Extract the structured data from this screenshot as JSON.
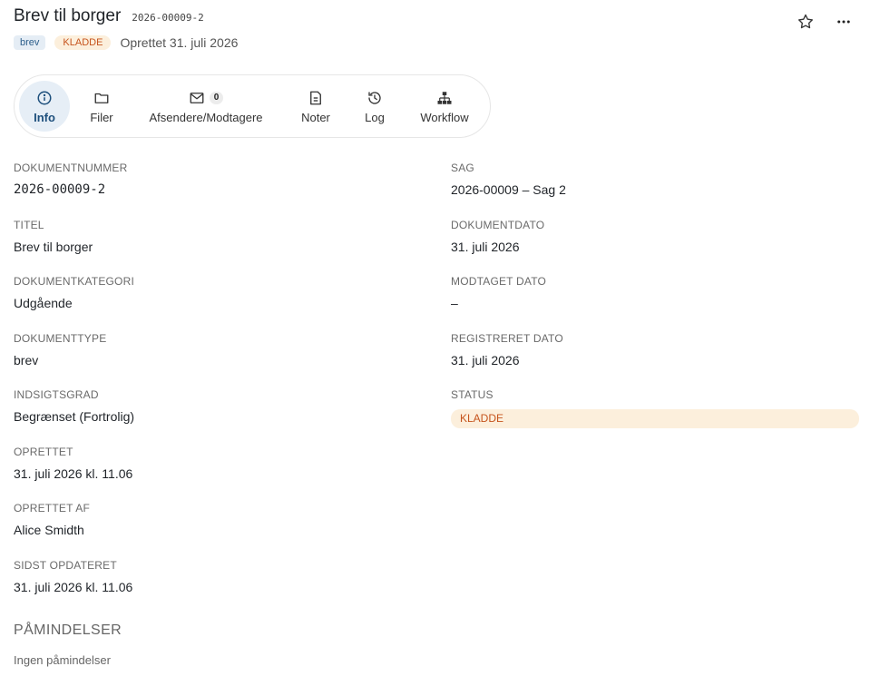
{
  "header": {
    "title": "Brev til borger",
    "doc_number": "2026-00009-2",
    "type_chip": "brev",
    "status_chip": "KLADDE",
    "created": "Oprettet 31. juli 2026"
  },
  "tabs": [
    {
      "label": "Info",
      "icon": "info-icon",
      "active": true
    },
    {
      "label": "Filer",
      "icon": "folder-icon"
    },
    {
      "label": "Afsendere/Modtagere",
      "icon": "mail-icon",
      "badge": "0"
    },
    {
      "label": "Noter",
      "icon": "note-icon"
    },
    {
      "label": "Log",
      "icon": "history-icon"
    },
    {
      "label": "Workflow",
      "icon": "workflow-icon"
    }
  ],
  "fields_left": [
    {
      "label": "DOKUMENTNUMMER",
      "value": "2026-00009-2"
    },
    {
      "label": "TITEL",
      "value": "Brev til borger"
    },
    {
      "label": "DOKUMENTKATEGORI",
      "value": "Udgående"
    },
    {
      "label": "DOKUMENTTYPE",
      "value": "brev"
    },
    {
      "label": "INDSIGTSGRAD",
      "value": "Begrænset (Fortrolig)"
    },
    {
      "label": "OPRETTET",
      "value": "31. juli 2026 kl. 11.06"
    },
    {
      "label": "OPRETTET AF",
      "value": "Alice Smidth"
    },
    {
      "label": "SIDST OPDATERET",
      "value": "31. juli 2026 kl. 11.06"
    }
  ],
  "fields_right": [
    {
      "label": "SAG",
      "value": "2026-00009 – Sag 2"
    },
    {
      "label": "DOKUMENTDATO",
      "value": "31. juli 2026"
    },
    {
      "label": "MODTAGET DATO",
      "value": "–"
    },
    {
      "label": "REGISTRERET DATO",
      "value": "31. juli 2026"
    },
    {
      "label": "STATUS",
      "value": "KLADDE"
    }
  ],
  "reminders": {
    "title": "PÅMINDELSER",
    "empty": "Ingen påmindelser"
  },
  "colors": {
    "accent": "#2a6aa3",
    "status_bg": "#fcefdc",
    "status_fg": "#c6541d"
  }
}
